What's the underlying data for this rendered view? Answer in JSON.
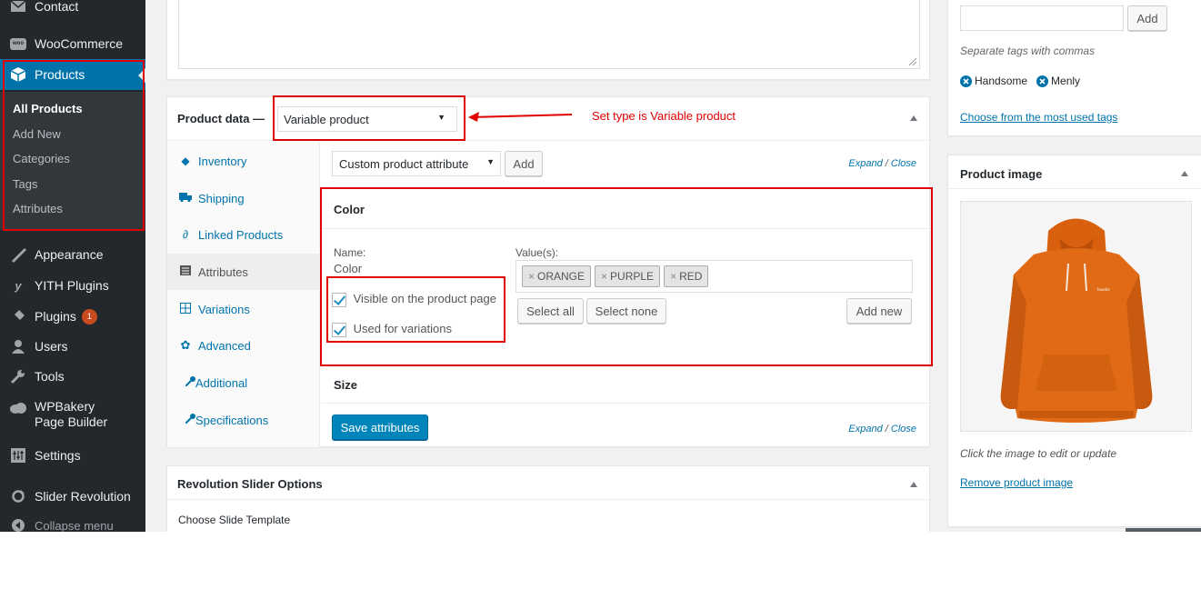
{
  "sidebar": {
    "contact": "Contact",
    "woocommerce": "WooCommerce",
    "woo_badge_text": "woo",
    "products": "Products",
    "submenu": [
      "All Products",
      "Add New",
      "Categories",
      "Tags",
      "Attributes"
    ],
    "appearance": "Appearance",
    "yith": "YITH Plugins",
    "plugins": "Plugins",
    "plugins_badge": "1",
    "users": "Users",
    "tools": "Tools",
    "wpbakery": "WPBakery Page Builder",
    "settings": "Settings",
    "slider_revolution": "Slider Revolution",
    "collapse": "Collapse menu"
  },
  "product_data": {
    "heading": "Product data —",
    "type_select": "Variable product",
    "annotation": "Set type is Variable product",
    "tabs": [
      {
        "label": "Inventory",
        "icon": "tag-icon"
      },
      {
        "label": "Shipping",
        "icon": "truck-icon"
      },
      {
        "label": "Linked Products",
        "icon": "link-icon"
      },
      {
        "label": "Attributes",
        "icon": "list-icon"
      },
      {
        "label": "Variations",
        "icon": "grid-icon"
      },
      {
        "label": "Advanced",
        "icon": "gear-icon"
      },
      {
        "label": "Additional",
        "icon": "wrench-icon"
      },
      {
        "label": "Specifications",
        "icon": "wrench-icon"
      }
    ],
    "attribute_select": "Custom product attribute",
    "add_button": "Add",
    "expand": "Expand",
    "sep": "/",
    "close": "Close",
    "attr_color": {
      "title": "Color",
      "name_label": "Name:",
      "name_value": "Color",
      "values_label": "Value(s):",
      "values": [
        "ORANGE",
        "PURPLE",
        "RED"
      ],
      "visible_label": "Visible on the product page",
      "variations_label": "Used for variations",
      "select_all": "Select all",
      "select_none": "Select none",
      "add_new": "Add new"
    },
    "attr_size": {
      "title": "Size"
    },
    "save_button": "Save attributes"
  },
  "revolution": {
    "heading": "Revolution Slider Options",
    "choose": "Choose Slide Template"
  },
  "tags_box": {
    "add_button": "Add",
    "hint": "Separate tags with commas",
    "tags": [
      "Handsome",
      "Menly"
    ],
    "most_used": "Choose from the most used tags"
  },
  "product_image": {
    "heading": "Product image",
    "hoodie_text": "hoodie",
    "hint": "Click the image to edit or update",
    "remove": "Remove product image"
  },
  "colors": {
    "accent": "#0073aa",
    "sidebar": "#23282d",
    "annotation": "#e00000",
    "hoodie": "#e06a16"
  }
}
